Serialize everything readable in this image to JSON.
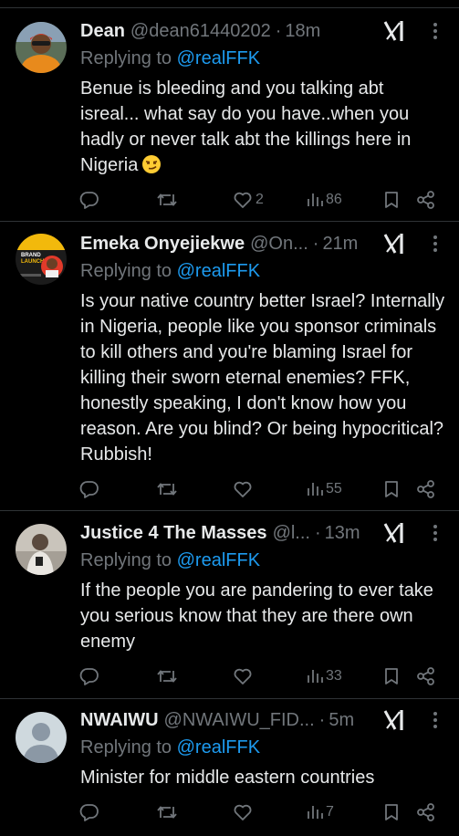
{
  "colors": {
    "background": "#000000",
    "text": "#e7e9ea",
    "muted": "#71767b",
    "link": "#1d9bf0",
    "divider": "#2f3336"
  },
  "tweets": [
    {
      "name": "Dean",
      "handle": "@dean61440202",
      "dot": "·",
      "time": "18m",
      "replying_prefix": "Replying to ",
      "replying_to": "@realFFK",
      "text": "Benue is bleeding and you talking abt isreal... what say do you have..when you hadly or never talk abt the killings here in Nigeria",
      "emoji": "smirking-face",
      "likes": "2",
      "views": "86",
      "avatar": "orange-shirt-person"
    },
    {
      "name": "Emeka Onyejiekwe",
      "handle": "@On...",
      "dot": "·",
      "time": "21m",
      "replying_prefix": "Replying to ",
      "replying_to": "@realFFK",
      "text": "Is your native country better Israel? Internally in Nigeria, people like you sponsor criminals to kill others and you're blaming Israel for killing their sworn eternal enemies? FFK, honestly speaking, I don't know how you reason. Are you blind? Or being hypocritical? Rubbish!",
      "likes": "",
      "views": "55",
      "avatar": "brand-launch-flyer"
    },
    {
      "name": "Justice 4 The Masses",
      "handle": "@l...",
      "dot": "·",
      "time": "13m",
      "replying_prefix": "Replying to ",
      "replying_to": "@realFFK",
      "text": "If the people you are pandering to ever take you serious know that they are there own enemy",
      "likes": "",
      "views": "33",
      "avatar": "person-with-phone"
    },
    {
      "name": "NWAIWU",
      "handle": "@NWAIWU_FID...",
      "dot": "·",
      "time": "5m",
      "replying_prefix": "Replying to ",
      "replying_to": "@realFFK",
      "text": "Minister for middle eastern countries",
      "likes": "",
      "views": "7",
      "avatar": "default-profile"
    }
  ],
  "avatar_texts": {
    "brand_line1": "BRAND",
    "brand_line2": "LAUNCH"
  }
}
